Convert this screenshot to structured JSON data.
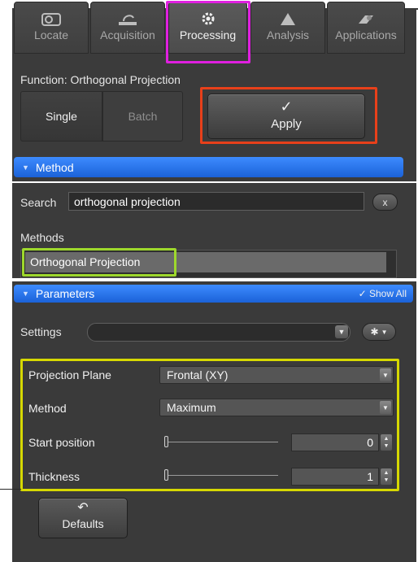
{
  "tabs": [
    {
      "label": "Locate",
      "icon": "locate-icon",
      "active": false
    },
    {
      "label": "Acquisition",
      "icon": "acquisition-icon",
      "active": false
    },
    {
      "label": "Processing",
      "icon": "processing-gear-icon",
      "active": true
    },
    {
      "label": "Analysis",
      "icon": "analysis-icon",
      "active": false
    },
    {
      "label": "Applications",
      "icon": "applications-icon",
      "active": false
    }
  ],
  "function": {
    "label": "Function:",
    "value": "Orthogonal Projection"
  },
  "mode": {
    "single": "Single",
    "batch": "Batch",
    "selected": "Single"
  },
  "apply": {
    "label": "Apply",
    "icon": "✓"
  },
  "method_section": {
    "title": "Method"
  },
  "search": {
    "label": "Search",
    "value": "orthogonal projection",
    "clear_label": "x"
  },
  "methods": {
    "label": "Methods",
    "items": [
      "Orthogonal Projection"
    ],
    "selected": "Orthogonal Projection"
  },
  "parameters": {
    "title": "Parameters",
    "show_all": "Show All",
    "settings_label": "Settings",
    "settings_value": "",
    "projection_plane": {
      "label": "Projection Plane",
      "value": "Frontal (XY)"
    },
    "method": {
      "label": "Method",
      "value": "Maximum"
    },
    "start_position": {
      "label": "Start position",
      "value": "0"
    },
    "thickness": {
      "label": "Thickness",
      "value": "1"
    },
    "defaults_label": "Defaults"
  },
  "colors": {
    "panel": "#3b3b3b",
    "section_header": "#2c73e8",
    "highlight_tab": "#e020e0",
    "highlight_apply": "#e8401a",
    "highlight_method": "#9ed82c",
    "highlight_params": "#d6d800"
  }
}
